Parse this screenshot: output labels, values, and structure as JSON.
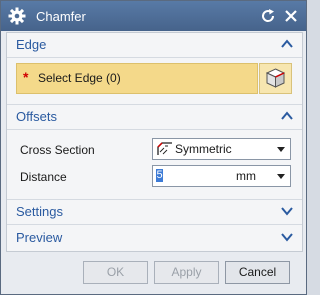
{
  "window": {
    "title": "Chamfer",
    "icon": "gear-icon"
  },
  "sections": {
    "edge": {
      "label": "Edge",
      "select_label": "Select Edge (0)",
      "required_marker": "*"
    },
    "offsets": {
      "label": "Offsets",
      "cross_section": {
        "label": "Cross Section",
        "value": "Symmetric"
      },
      "distance": {
        "label": "Distance",
        "value": "5",
        "unit": "mm"
      }
    },
    "settings": {
      "label": "Settings"
    },
    "preview": {
      "label": "Preview"
    }
  },
  "buttons": {
    "ok": "OK",
    "apply": "Apply",
    "cancel": "Cancel"
  },
  "colors": {
    "accent": "#2a5aa0",
    "required": "#d10000",
    "selection": "#f4d98a",
    "titlebar": "#4d6b94"
  }
}
